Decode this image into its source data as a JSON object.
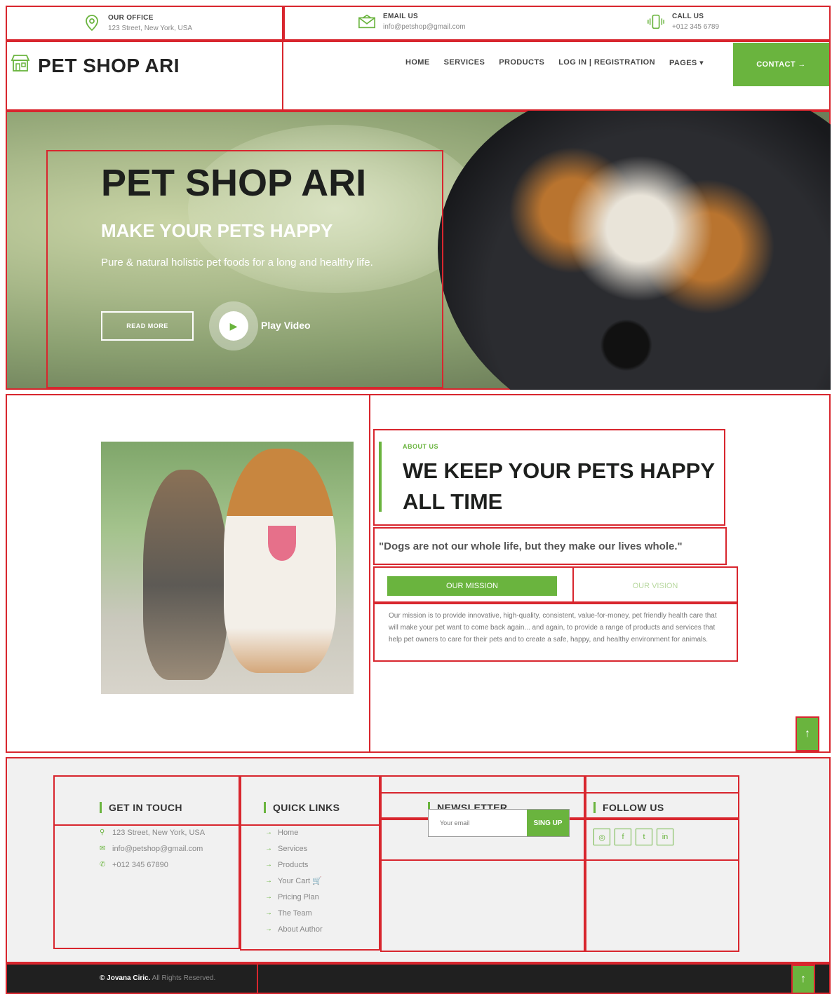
{
  "topbar": {
    "office": {
      "title": "OUR OFFICE",
      "value": "123 Street, New York, USA",
      "icon": "map-pin-icon"
    },
    "email": {
      "title": "EMAIL US",
      "value": "info@petshop@gmail.com",
      "icon": "envelope-icon"
    },
    "call": {
      "title": "CALL US",
      "value": "+012 345 6789",
      "icon": "phone-icon"
    }
  },
  "brand": {
    "name": "PET SHOP ARI",
    "icon": "shop-icon"
  },
  "nav": {
    "items": [
      "HOME",
      "SERVICES",
      "PRODUCTS",
      "LOG IN | REGISTRATION",
      "PAGES ▾"
    ],
    "contact": "CONTACT →"
  },
  "hero": {
    "title": "PET SHOP ARI",
    "subtitle": "MAKE YOUR PETS HAPPY",
    "description": "Pure & natural holistic pet foods for a long and healthy life.",
    "read_more": "READ MORE",
    "play_label": "Play Video"
  },
  "about": {
    "kicker": "ABOUT US",
    "title": "WE KEEP YOUR PETS HAPPY ALL TIME",
    "quote": "\"Dogs are not our whole life, but they make our lives whole.\"",
    "tabs": {
      "mission": "OUR MISSION",
      "vision": "OUR VISION"
    },
    "mission_text": "Our mission is to provide innovative, high-quality, consistent, value-for-money, pet friendly health care that will make your pet want to come back again... and again, to provide a range of products and services that help pet owners to care for their pets and to create a safe, happy, and healthy environment for animals."
  },
  "footer": {
    "touch": {
      "title": "GET IN TOUCH",
      "address": "123 Street, New York, USA",
      "email": "info@petshop@gmail.com",
      "phone": "+012 345 67890"
    },
    "links": {
      "title": "QUICK LINKS",
      "items": [
        "Home",
        "Services",
        "Products",
        "Your Cart 🛒",
        "Pricing Plan",
        "The Team",
        "About Author"
      ]
    },
    "newsletter": {
      "title": "NEWSLETTER",
      "placeholder": "Your email",
      "button": "SING UP"
    },
    "follow": {
      "title": "FOLLOW US",
      "icons": [
        "instagram-icon",
        "facebook-icon",
        "twitter-icon",
        "linkedin-icon"
      ]
    }
  },
  "copyright": {
    "name": "© Jovana Ciric.",
    "rest": " All Rights Reserved."
  },
  "colors": {
    "accent": "#6ab43e",
    "outline": "#d8262e",
    "dark": "#202020"
  }
}
